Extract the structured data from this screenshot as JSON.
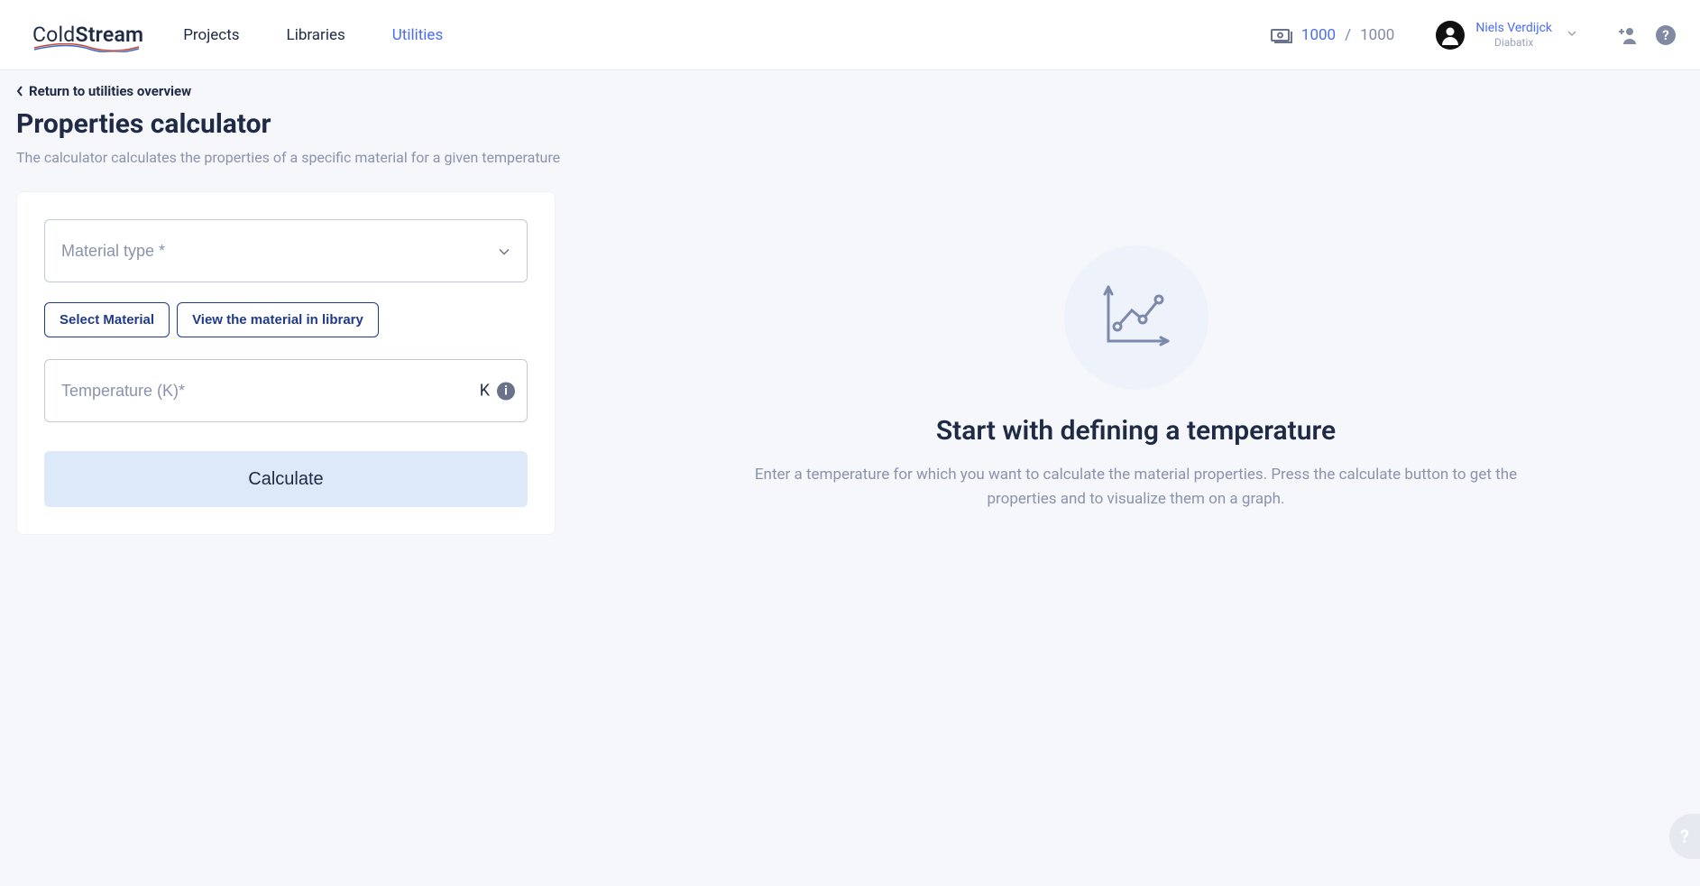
{
  "header": {
    "logo_a": "Cold",
    "logo_b": "Stream",
    "nav": [
      {
        "label": "Projects",
        "active": false
      },
      {
        "label": "Libraries",
        "active": false
      },
      {
        "label": "Utilities",
        "active": true
      }
    ],
    "credits_current": "1000",
    "credits_sep": " / ",
    "credits_max": "1000",
    "user_name": "Niels Verdijck",
    "user_org": "Diabatix"
  },
  "page": {
    "back_label": "Return to utilities overview",
    "title": "Properties calculator",
    "description": "The calculator calculates the properties of a specific material for a given temperature"
  },
  "form": {
    "material_type_label": "Material type *",
    "select_material_btn": "Select Material",
    "view_material_btn": "View the material in library",
    "temperature_placeholder": "Temperature (K)*",
    "temperature_unit": "K",
    "calculate_btn": "Calculate"
  },
  "placeholder": {
    "title": "Start with defining a temperature",
    "desc": "Enter a temperature for which you want to calculate the material properties. Press the calculate button to get the properties and to visualize them on a graph."
  }
}
